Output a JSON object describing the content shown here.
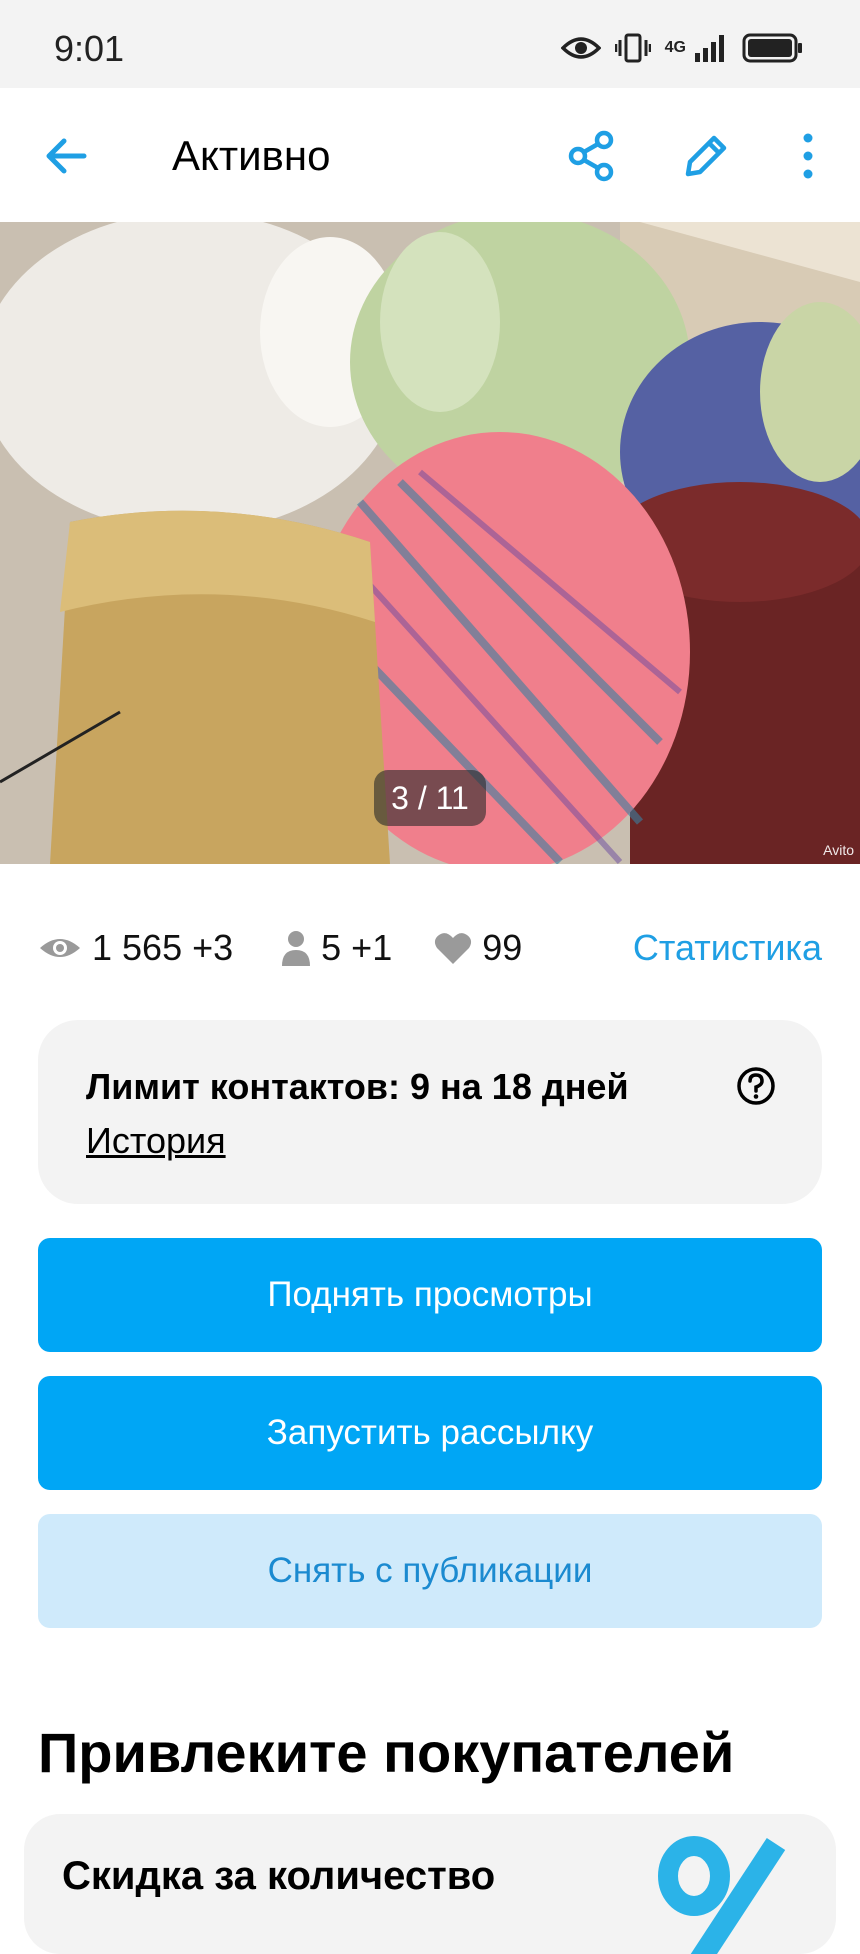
{
  "status_bar": {
    "time": "9:01",
    "network": "4G",
    "icons": [
      "eye-icon",
      "vibrate-icon",
      "signal-icon",
      "battery-icon"
    ]
  },
  "app_bar": {
    "title": "Активно",
    "icons": [
      "back-arrow-icon",
      "share-icon",
      "edit-pencil-icon",
      "more-vert-icon"
    ],
    "accent": "#1f9fe4"
  },
  "gallery": {
    "counter": "3 / 11",
    "watermark": "Avito"
  },
  "stats": {
    "views": "1 565 +3",
    "contacts": "5 +1",
    "favorites": "99",
    "link": "Статистика"
  },
  "limit": {
    "title": "Лимит контактов: 9 на 18 дней",
    "history": "История"
  },
  "actions": {
    "raise_views": "Поднять просмотры",
    "mailing": "Запустить рассылку",
    "unpublish": "Снять с публикации"
  },
  "promo": {
    "section_title": "Привлеките покупателей",
    "card_title": "Скидка за количество",
    "art_icon": "percent-icon"
  },
  "colors": {
    "primary_button": "#00a6f5",
    "secondary_button": "#cfeafb",
    "link": "#1f9fe4"
  }
}
